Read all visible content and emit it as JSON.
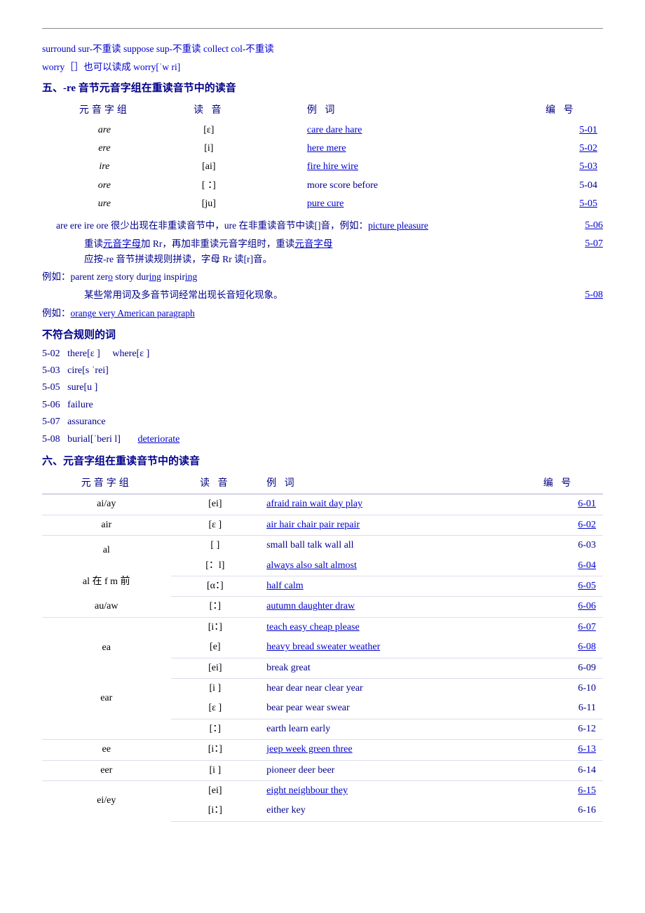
{
  "top_border": true,
  "intro": {
    "line1": "surround  sur-不重读       suppose  sup-不重读       collect  col-不重读",
    "line2": "worry［］也可以读成 worry[ˈw ri]"
  },
  "section5": {
    "title": "五、-re 音节元音字组在重读音节中的读音",
    "table_headers": [
      "元音字组",
      "读 音",
      "例 词",
      "编 号"
    ],
    "rows": [
      {
        "vowel": "are",
        "phonetic": "[ε]",
        "examples": "care dare hare",
        "code": "5-01",
        "ex_underline": true
      },
      {
        "vowel": "ere",
        "phonetic": "[i]",
        "examples": "here mere",
        "code": "5-02",
        "ex_underline": true
      },
      {
        "vowel": "ire",
        "phonetic": "[ai]",
        "examples": "fire hire wire",
        "code": "5-03",
        "ex_underline": true
      },
      {
        "vowel": "ore",
        "phonetic": "[：]",
        "examples": "more score before",
        "code": "5-04",
        "ex_underline": true
      },
      {
        "vowel": "ure",
        "phonetic": "[ju]",
        "examples": "pure cure",
        "code": "5-05",
        "ex_underline": true
      }
    ],
    "note1": "are ere ire ore 很少出现在非重读音节中，ure 在非重读音节",
    "note1b": "中读[]音，例如：",
    "note1_example": "picture pleasure",
    "note1_code": "5-06",
    "note2_prefix": "重读元音字母加 Rr，再加非重读元音字组时，重读",
    "note2_underline": "元音字母",
    "note2_mid": "应按-re 音节拼读规则拼读，字母 Rr 读[r]音。",
    "note2_code": "5-07",
    "note2_example": "例如：parent zero story dur",
    "note2_example_ul": "ing",
    "note2_example2": " inspir",
    "note2_example2_ul": "ing",
    "note3": "某些常用词及多音节词经常出现长音短化现象。",
    "note3_code": "5-08",
    "note3_example": "例如：",
    "note3_ex_ul": "orange very American par",
    "note3_ex_ul2": "agraph"
  },
  "irregular": {
    "title": "不符合规则的词",
    "items": [
      {
        "code": "5-02",
        "text": "there[ε ]   where[ε ]"
      },
      {
        "code": "5-03",
        "text": "cire[s ˈrei]"
      },
      {
        "code": "5-05",
        "text": "sure[u ]"
      },
      {
        "code": "5-06",
        "text": "failure"
      },
      {
        "code": "5-07",
        "text": "assurance"
      },
      {
        "code": "5-08",
        "text": "burial[ˈberi l]      deteriorate"
      }
    ]
  },
  "section6": {
    "title": "六、元音字组在重读音节中的读音",
    "table_headers": [
      "元音字组",
      "读 音",
      "例 词",
      "编 号"
    ],
    "rows": [
      {
        "vowel": "ai/ay",
        "phonetic": "[ei]",
        "examples": "afraid rain wait day play",
        "code": "6-01",
        "underline": true,
        "rowspan": 1
      },
      {
        "vowel": "air",
        "phonetic": "[ε ]",
        "examples": "air hair chair pair repair",
        "code": "6-02",
        "underline": true,
        "rowspan": 1
      },
      {
        "vowel_empty": true,
        "phonetic": "[ ]",
        "examples": "small ball talk wall all",
        "code": "6-03",
        "underline": false,
        "ex_plain": true
      },
      {
        "vowel": "al",
        "phonetic": "[：l]",
        "examples": "always also salt almost",
        "code": "6-04",
        "underline": true,
        "rowspan": 3,
        "al_note": "al 在 f m 前"
      },
      {
        "vowel_note": "al 在 f m 前",
        "phonetic": "[α：]",
        "examples": "half calm",
        "code": "6-05",
        "underline": true
      },
      {
        "vowel": "au/aw",
        "phonetic": "[：]",
        "examples": "autumn daughter draw",
        "code": "6-06",
        "underline": true
      },
      {
        "vowel_empty": true,
        "phonetic": "[i：]",
        "examples": "teach easy cheap please",
        "code": "6-07",
        "underline": true
      },
      {
        "vowel": "ea",
        "phonetic": "[e]",
        "examples": "heavy bread sweater weather",
        "code": "6-08",
        "underline": true,
        "rowspan": 3
      },
      {
        "vowel_empty": true,
        "phonetic": "[ei]",
        "examples": "break great",
        "code": "6-09",
        "ex_plain": true
      },
      {
        "vowel_empty": true,
        "phonetic": "[i ]",
        "examples": "hear dear near clear year",
        "code": "6-10",
        "ex_plain": true
      },
      {
        "vowel": "ear",
        "phonetic": "[ε ]",
        "examples": "bear pear wear swear",
        "code": "6-11",
        "underline": false,
        "ex_plain": true,
        "rowspan": 2
      },
      {
        "vowel_empty": true,
        "phonetic": "[：]",
        "examples": "earth learn early",
        "code": "6-12",
        "underline": false,
        "ex_plain": true
      },
      {
        "vowel": "ee",
        "phonetic": "[i：]",
        "examples": "jeep week green three",
        "code": "6-13",
        "underline": true
      },
      {
        "vowel": "eer",
        "phonetic": "[i ]",
        "examples": "pioneer deer beer",
        "code": "6-14",
        "ex_plain": true
      },
      {
        "vowel": "ei/ey",
        "phonetic": "[ei]",
        "examples": "eight neighbour they",
        "code": "6-15",
        "underline": true,
        "rowspan": 2
      },
      {
        "vowel_empty": true,
        "phonetic": "[i：]",
        "examples": "either key",
        "code": "6-16",
        "underline": false,
        "ex_plain": true
      }
    ]
  }
}
